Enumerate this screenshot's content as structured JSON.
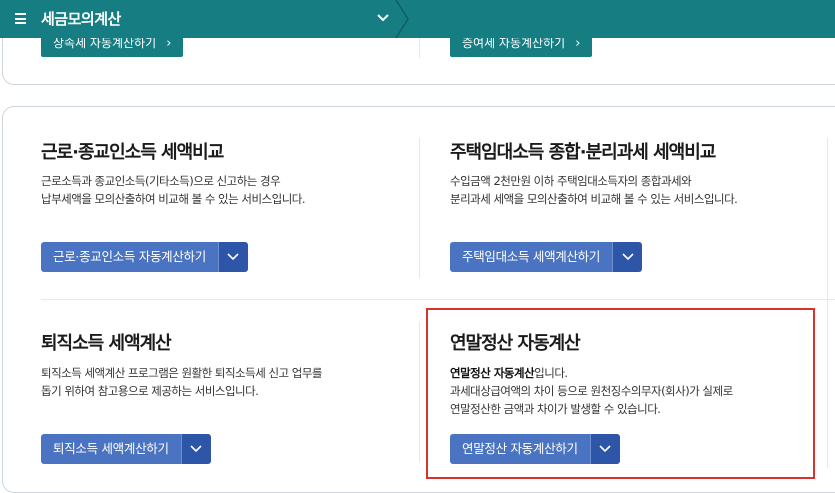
{
  "topbar": {
    "title": "세금모의계산"
  },
  "peek": {
    "left_button": "상속세 자동계산하기",
    "right_button": "증여세 자동계산하기"
  },
  "sections": [
    {
      "title": "근로·종교인소득 세액비교",
      "desc_lines": [
        "근로소득과 종교인소득(기타소득)으로 신고하는 경우",
        "납부세액을 모의산출하여 비교해 볼 수 있는 서비스입니다."
      ],
      "button": "근로·종교인소득 자동계산하기"
    },
    {
      "title": "주택임대소득 종합·분리과세 세액비교",
      "desc_lines": [
        "수입금액 2천만원 이하 주택임대소득자의 종합과세와",
        "분리과세 세액을 모의산출하여 비교해 볼 수 있는 서비스입니다."
      ],
      "button": "주택임대소득 세액계산하기"
    },
    {
      "title": "퇴직소득 세액계산",
      "desc_lines": [
        "퇴직소득 세액계산 프로그램은 원활한 퇴직소득세 신고 업무를",
        "돕기 위하여 참고용으로 제공하는 서비스입니다."
      ],
      "button": "퇴직소득 세액계산하기"
    },
    {
      "title": "연말정산 자동계산",
      "desc_bold": "연말정산 자동계산",
      "desc_bold_tail": "입니다.",
      "desc_lines": [
        "과세대상급여액의 차이 등으로 원천징수의무자(회사)가 실제로",
        "연말정산한 금액과 차이가 발생할 수 있습니다."
      ],
      "button": "연말정산 자동계산하기"
    }
  ],
  "colors": {
    "topbar": "#167e82",
    "button_main": "#4a74c2",
    "button_drop": "#2e56a8",
    "highlight": "#d9312b"
  }
}
